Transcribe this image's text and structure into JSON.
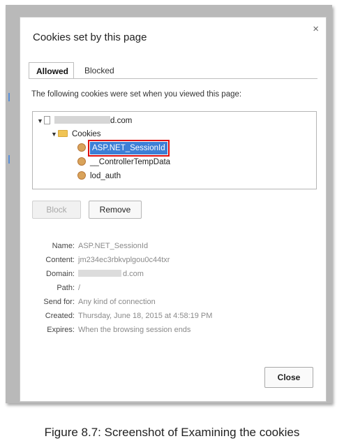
{
  "dialog": {
    "title": "Cookies set by this page",
    "close_glyph": "×",
    "tabs": [
      {
        "label": "Allowed",
        "active": true
      },
      {
        "label": "Blocked",
        "active": false
      }
    ],
    "description": "The following cookies were set when you viewed this page:",
    "tree": {
      "domain_suffix": "d.com",
      "folder_label": "Cookies",
      "cookies": [
        "ASP.NET_SessionId",
        "__ControllerTempData",
        "lod_auth"
      ],
      "selected_index": 0
    },
    "buttons": {
      "block": "Block",
      "remove": "Remove",
      "close": "Close"
    },
    "details": {
      "name_label": "Name:",
      "name_value": "ASP.NET_SessionId",
      "content_label": "Content:",
      "content_value": "jm234ec3rbkvplgou0c44txr",
      "domain_label": "Domain:",
      "domain_value": "d.com",
      "path_label": "Path:",
      "path_value": "/",
      "sendfor_label": "Send for:",
      "sendfor_value": "Any kind of connection",
      "created_label": "Created:",
      "created_value": "Thursday, June 18, 2015 at 4:58:19 PM",
      "expires_label": "Expires:",
      "expires_value": "When the browsing session ends"
    }
  },
  "caption": "Figure 8.7: Screenshot of Examining the cookies",
  "colors": {
    "selection": "#3d7fd6",
    "highlight_box": "#e01010",
    "frame": "#b9b9b9"
  }
}
